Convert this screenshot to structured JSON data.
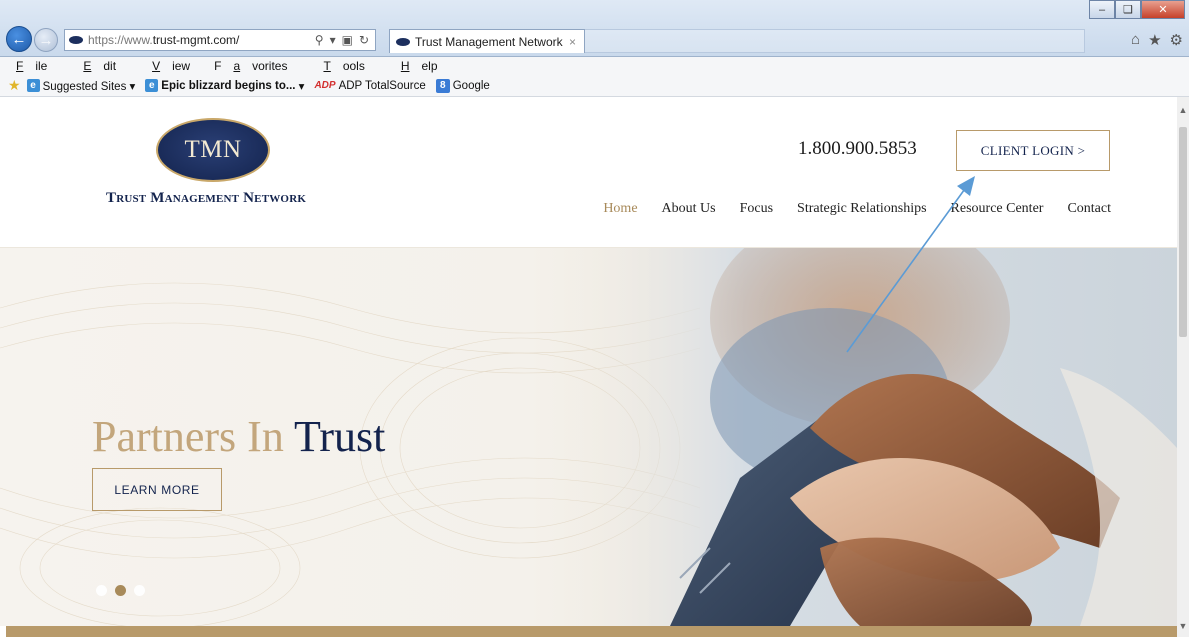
{
  "browser": {
    "address_url": "https://www.trust-mgmt.com/",
    "address_prefix": "https://www.",
    "address_domain": "trust-mgmt.com/",
    "tab_title": "Trust Management Network",
    "tab_close": "×",
    "menu": [
      {
        "prefix": "",
        "u": "F",
        "rest": "ile"
      },
      {
        "prefix": "",
        "u": "E",
        "rest": "dit"
      },
      {
        "prefix": "",
        "u": "V",
        "rest": "iew"
      },
      {
        "prefix": "F",
        "u": "a",
        "rest": "vorites"
      },
      {
        "prefix": "",
        "u": "T",
        "rest": "ools"
      },
      {
        "prefix": "",
        "u": "H",
        "rest": "elp"
      }
    ],
    "favorites": {
      "suggested": "Suggested Sites ▾",
      "blizzard": "Epic blizzard begins to...",
      "blizzard_arrow": "▾",
      "adp": "ADP TotalSource",
      "google": "Google"
    }
  },
  "site": {
    "logo_text": "TMN",
    "logo_name": "Trust Management Network",
    "phone": "1.800.900.5853",
    "client_login": "CLIENT LOGIN >",
    "nav": [
      {
        "label": "Home",
        "active": true
      },
      {
        "label": "About Us",
        "active": false
      },
      {
        "label": "Focus",
        "active": false
      },
      {
        "label": "Strategic Relationships",
        "active": false
      },
      {
        "label": "Resource Center",
        "active": false
      },
      {
        "label": "Contact",
        "active": false
      }
    ],
    "hero": {
      "tagline_light": "Partners In ",
      "tagline_dark": "Trust",
      "cta": "LEARN MORE",
      "slides": 3,
      "active_slide": 2
    }
  },
  "colors": {
    "navy": "#13234d",
    "gold": "#b89a6a",
    "gold_light": "#c3a67c",
    "arrow": "#5b9bd5"
  }
}
